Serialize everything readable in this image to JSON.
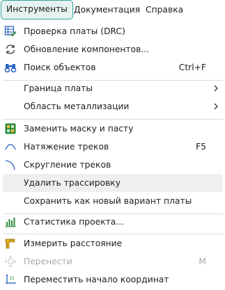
{
  "menubar": {
    "items": [
      {
        "label": "Инструменты",
        "active": true
      },
      {
        "label": "Документация"
      },
      {
        "label": "Справка"
      }
    ]
  },
  "menu": {
    "items": [
      {
        "label": "Проверка платы (DRC)",
        "icon": "checklist-icon"
      },
      {
        "label": "Обновление компонентов...",
        "icon": "refresh-icon"
      },
      {
        "label": "Поиск объектов",
        "shortcut": "Ctrl+F",
        "icon": "binoculars-icon"
      },
      {
        "label": "Граница платы",
        "submenu": true
      },
      {
        "label": "Область металлизации",
        "submenu": true
      },
      {
        "label": "Заменить маску и пасту",
        "icon": "mask-paste-icon"
      },
      {
        "label": "Натяжение треков",
        "shortcut": "F5",
        "icon": "track-tension-icon"
      },
      {
        "label": "Скругление треков",
        "icon": "arc-icon"
      },
      {
        "label": "Удалить трассировку",
        "hovered": true
      },
      {
        "label": "Сохранить как новый вариант платы"
      },
      {
        "label": "Статистика проекта...",
        "icon": "bar-chart-icon"
      },
      {
        "label": "Измерить расстояние",
        "icon": "ruler-icon"
      },
      {
        "label": "Перенести",
        "shortcut": "M",
        "disabled": true,
        "icon": "move-icon"
      },
      {
        "label": "Переместить начало координат",
        "icon": "origin-icon"
      }
    ]
  },
  "colors": {
    "accent": "#2fa597",
    "active_bg": "#e6f2f0",
    "hover_bg": "#efefef",
    "disabled_text": "#a8a8a8",
    "icon_green": "#2e8b3a",
    "icon_blue": "#2b63c1",
    "icon_yellow": "#e0b020"
  }
}
